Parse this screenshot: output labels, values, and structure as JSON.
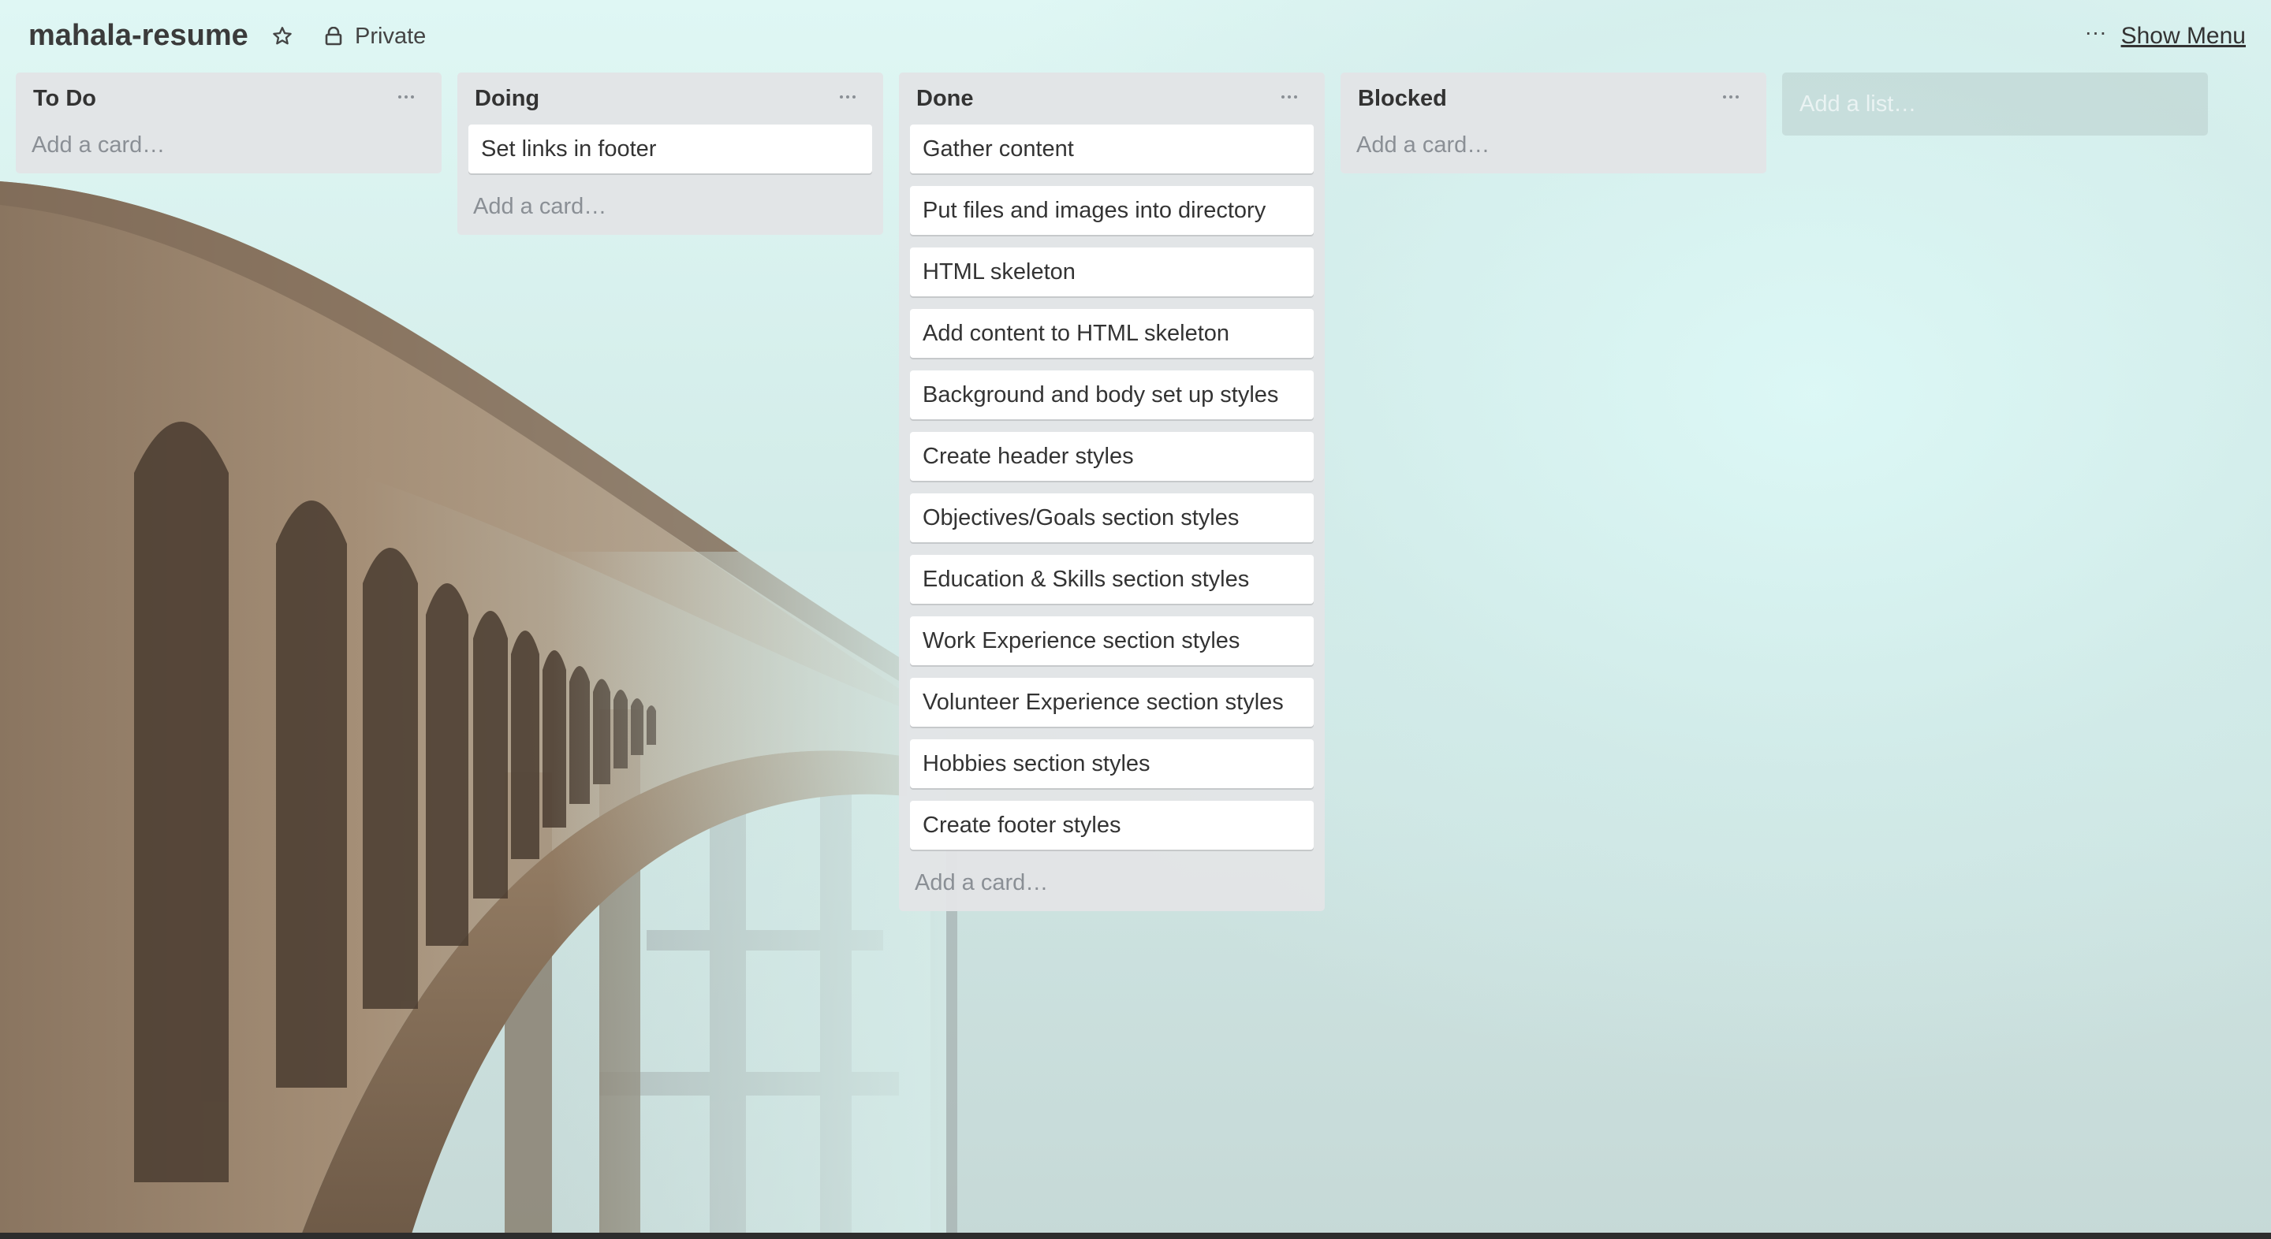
{
  "header": {
    "board_title": "mahala-resume",
    "star_icon": "star-outline-icon",
    "visibility_icon": "lock-icon",
    "visibility_label": "Private",
    "menu_icon": "ellipsis-icon",
    "show_menu_label": "Show Menu"
  },
  "lists": [
    {
      "title": "To Do",
      "cards": [],
      "add_card_label": "Add a card…"
    },
    {
      "title": "Doing",
      "cards": [
        "Set links in footer"
      ],
      "add_card_label": "Add a card…"
    },
    {
      "title": "Done",
      "cards": [
        "Gather content",
        "Put files and images into directory",
        "HTML skeleton",
        "Add content to HTML skeleton",
        "Background and body set up styles",
        "Create header styles",
        "Objectives/Goals section styles",
        "Education & Skills section styles",
        "Work Experience section styles",
        "Volunteer Experience section styles",
        "Hobbies section styles",
        "Create footer styles"
      ],
      "add_card_label": "Add a card…"
    },
    {
      "title": "Blocked",
      "cards": [],
      "add_card_label": "Add a card…"
    }
  ],
  "add_list_label": "Add a list…",
  "colors": {
    "list_background": "#e2e4e6",
    "card_background": "#ffffff",
    "muted_text": "#8a8f95",
    "background_fog": "#d2ebe8"
  }
}
